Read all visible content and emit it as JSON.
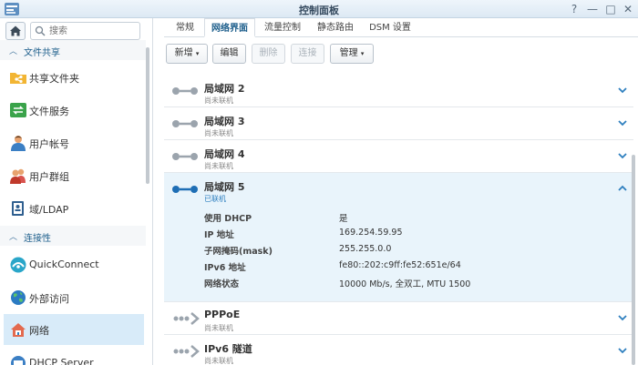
{
  "window": {
    "title": "控制面板"
  },
  "search": {
    "placeholder": "搜索"
  },
  "sidebar": {
    "sections": [
      {
        "label": "文件共享"
      },
      {
        "label": "连接性"
      }
    ],
    "items": [
      {
        "label": "共享文件夹",
        "icon": "share-folder-icon"
      },
      {
        "label": "文件服务",
        "icon": "file-services-icon"
      },
      {
        "label": "用户帐号",
        "icon": "user-icon"
      },
      {
        "label": "用户群组",
        "icon": "user-group-icon"
      },
      {
        "label": "域/LDAP",
        "icon": "domain-ldap-icon"
      },
      {
        "label": "QuickConnect",
        "icon": "quickconnect-icon"
      },
      {
        "label": "外部访问",
        "icon": "globe-icon"
      },
      {
        "label": "网络",
        "icon": "network-home-icon",
        "active": true
      },
      {
        "label": "DHCP Server",
        "icon": "dhcp-server-icon"
      }
    ]
  },
  "tabs": [
    {
      "label": "常规"
    },
    {
      "label": "网络界面",
      "active": true
    },
    {
      "label": "流量控制"
    },
    {
      "label": "静态路由"
    },
    {
      "label": "DSM 设置"
    }
  ],
  "toolbar": {
    "create": "新增",
    "edit": "编辑",
    "delete": "删除",
    "connect": "连接",
    "manage": "管理"
  },
  "interfaces": [
    {
      "name": "局域网 2",
      "status": "尚未联机"
    },
    {
      "name": "局域网 3",
      "status": "尚未联机"
    },
    {
      "name": "局域网 4",
      "status": "尚未联机"
    },
    {
      "name": "局域网 5",
      "status": "已联机",
      "details": [
        {
          "key": "使用 DHCP",
          "value": "是"
        },
        {
          "key": "IP 地址",
          "value": "169.254.59.95"
        },
        {
          "key": "子网掩码(mask)",
          "value": "255.255.0.0"
        },
        {
          "key": "IPv6 地址",
          "value": "fe80::202:c9ff:fe52:651e/64"
        },
        {
          "key": "网络状态",
          "value": "10000 Mb/s, 全双工, MTU 1500"
        }
      ]
    },
    {
      "name": "PPPoE",
      "status": "尚未联机"
    },
    {
      "name": "IPv6 隧道",
      "status": "尚未联机"
    }
  ],
  "colors": {
    "accent": "#1e6eb5",
    "active_bg": "#d8ebf9",
    "expanded_bg": "#e9f4fb"
  }
}
